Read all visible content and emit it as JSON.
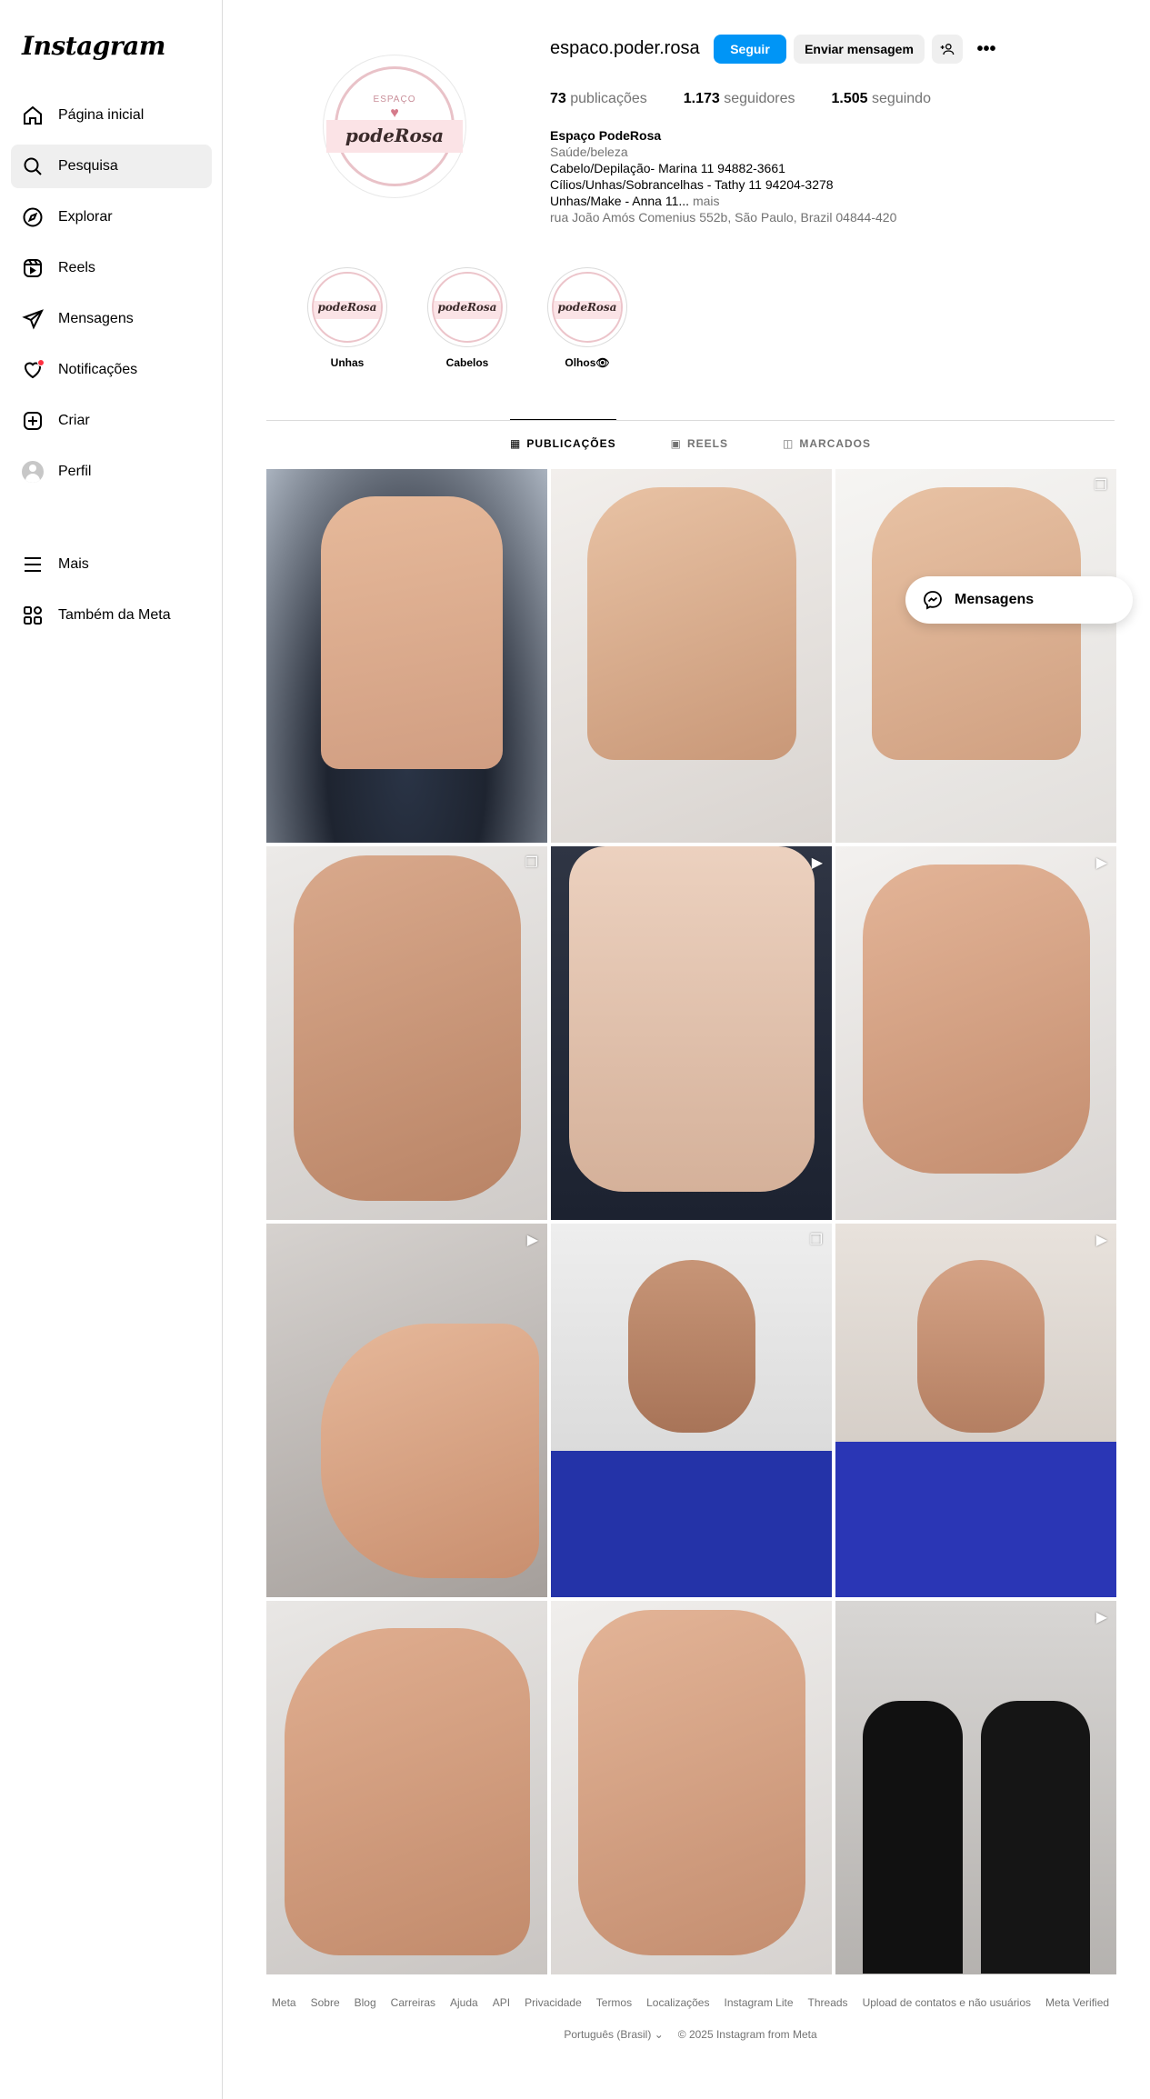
{
  "sidebar": {
    "logo": "Instagram",
    "items": [
      {
        "label": "Página inicial",
        "icon": "home-icon"
      },
      {
        "label": "Pesquisa",
        "icon": "search-icon"
      },
      {
        "label": "Explorar",
        "icon": "compass-icon"
      },
      {
        "label": "Reels",
        "icon": "reels-icon"
      },
      {
        "label": "Mensagens",
        "icon": "send-icon"
      },
      {
        "label": "Notificações",
        "icon": "heart-icon"
      },
      {
        "label": "Criar",
        "icon": "plus-square-icon"
      },
      {
        "label": "Perfil",
        "icon": "avatar-icon"
      }
    ],
    "lower": [
      {
        "label": "Mais",
        "icon": "menu-icon"
      },
      {
        "label": "Também da Meta",
        "icon": "meta-apps-icon"
      }
    ],
    "active_index": 1
  },
  "profile": {
    "username": "espaco.poder.rosa",
    "logo_top": "ESPAÇO",
    "logo_name": "podeRosa",
    "follow_label": "Seguir",
    "message_label": "Enviar mensagem",
    "stats": {
      "posts_count": "73",
      "posts_label": "publicações",
      "followers_count": "1.173",
      "followers_label": "seguidores",
      "following_count": "1.505",
      "following_label": "seguindo"
    },
    "bio": {
      "name": "Espaço PodeRosa",
      "category": "Saúde/beleza",
      "line1": "Cabelo/Depilação- Marina 11 94882-3661",
      "line2": "Cílios/Unhas/Sobrancelhas - Tathy 11 94204-3278",
      "line3": "Unhas/Make - Anna 11...",
      "more": "mais",
      "address": "rua João Amós Comenius 552b, São Paulo, Brazil 04844-420"
    }
  },
  "highlights": [
    {
      "label": "Unhas",
      "name": "podeRosa"
    },
    {
      "label": "Cabelos",
      "name": "podeRosa"
    },
    {
      "label": "Olhos👁",
      "name": "podeRosa"
    }
  ],
  "tabs": [
    {
      "label": "PUBLICAÇÕES",
      "icon": "grid-icon"
    },
    {
      "label": "REELS",
      "icon": "reels-icon"
    },
    {
      "label": "MARCADOS",
      "icon": "tagged-icon"
    }
  ],
  "floating_messages": "Mensagens",
  "footer": {
    "links": [
      "Meta",
      "Sobre",
      "Blog",
      "Carreiras",
      "Ajuda",
      "API",
      "Privacidade",
      "Termos",
      "Localizações",
      "Instagram Lite",
      "Threads",
      "Upload de contatos e não usuários",
      "Meta Verified"
    ],
    "language": "Português (Brasil)",
    "copyright": "© 2025 Instagram from Meta"
  }
}
